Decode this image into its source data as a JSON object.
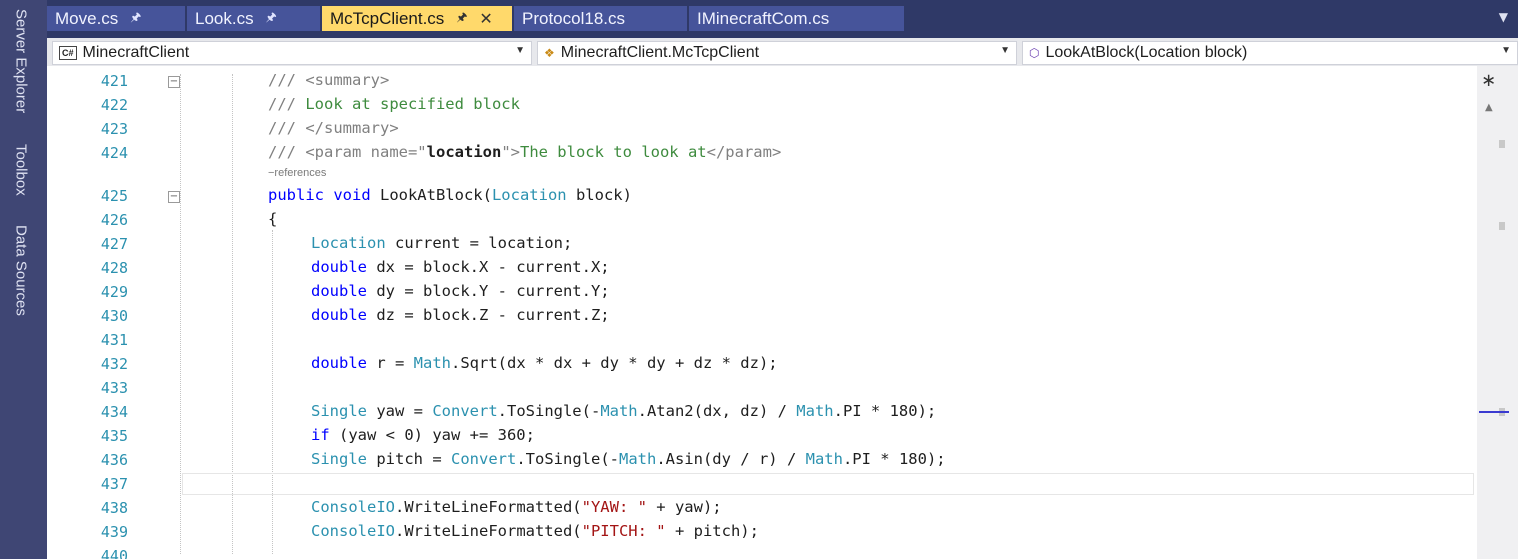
{
  "side_strip": {
    "tabs": [
      "Server Explorer",
      "Toolbox",
      "Data Sources"
    ]
  },
  "tabs": [
    {
      "label": "Move.cs",
      "pinned": true
    },
    {
      "label": "Look.cs",
      "pinned": true
    },
    {
      "label": "McTcpClient.cs",
      "pinned": true,
      "active": true
    },
    {
      "label": "Protocol18.cs"
    },
    {
      "label": "IMinecraftCom.cs"
    }
  ],
  "nav": {
    "project": "MinecraftClient",
    "class": "MinecraftClient.McTcpClient",
    "member": "LookAtBlock(Location block)"
  },
  "editor": {
    "references_label": "−references",
    "line_numbers": [
      "421",
      "422",
      "423",
      "424",
      "425",
      "426",
      "427",
      "428",
      "429",
      "430",
      "431",
      "432",
      "433",
      "434",
      "435",
      "436",
      "437",
      "438",
      "439",
      "440"
    ],
    "code": {
      "l421_a": "/// ",
      "l421_b": "<summary>",
      "l422_a": "/// ",
      "l422_b": "Look at specified block",
      "l423_a": "/// ",
      "l423_b": "</summary>",
      "l424_a": "/// ",
      "l424_b": "<param name=\"",
      "l424_c": "location",
      "l424_d": "\">",
      "l424_e": "The block to look at",
      "l424_f": "</param>",
      "l425_a": "public void ",
      "l425_b": "LookAtBlock(",
      "l425_c": "Location",
      "l425_d": " block)",
      "l426": "{",
      "l427_a": "Location",
      "l427_b": " current = location;",
      "l428_a": "double",
      "l428_b": " dx = block.X - current.X;",
      "l429_a": "double",
      "l429_b": " dy = block.Y - current.Y;",
      "l430_a": "double",
      "l430_b": " dz = block.Z - current.Z;",
      "l432_a": "double",
      "l432_b": " r = ",
      "l432_c": "Math",
      "l432_d": ".Sqrt(dx * dx + dy * dy + dz * dz);",
      "l434_a": "Single",
      "l434_b": " yaw = ",
      "l434_c": "Convert",
      "l434_d": ".ToSingle(-",
      "l434_e": "Math",
      "l434_f": ".Atan2(dx, dz) / ",
      "l434_g": "Math",
      "l434_h": ".PI * 180);",
      "l435_a": "if",
      "l435_b": " (yaw < 0) yaw += 360;",
      "l436_a": "Single",
      "l436_b": " pitch = ",
      "l436_c": "Convert",
      "l436_d": ".ToSingle(-",
      "l436_e": "Math",
      "l436_f": ".Asin(dy / r) / ",
      "l436_g": "Math",
      "l436_h": ".PI * 180);",
      "l438_a": "ConsoleIO",
      "l438_b": ".WriteLineFormatted(",
      "l438_c": "\"YAW: \"",
      "l438_d": " + yaw);",
      "l439_a": "ConsoleIO",
      "l439_b": ".WriteLineFormatted(",
      "l439_c": "\"PITCH: \"",
      "l439_d": " + pitch);"
    }
  }
}
